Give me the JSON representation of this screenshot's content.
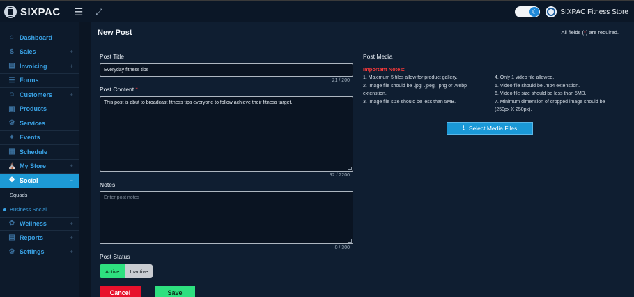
{
  "header": {
    "logo_text": "SIXPAC",
    "store_name": "SIXPAC Fitness Store",
    "menu_icon": "hamburger-icon",
    "expand_icon": "expand-icon",
    "theme_icon": "moon-icon"
  },
  "sidebar": {
    "items": [
      {
        "label": "Dashboard",
        "icon": "home-icon",
        "has_plus": false
      },
      {
        "label": "Sales",
        "icon": "dollar-icon",
        "has_plus": true
      },
      {
        "label": "Invoicing",
        "icon": "invoice-icon",
        "has_plus": true
      },
      {
        "label": "Forms",
        "icon": "form-icon",
        "has_plus": false
      },
      {
        "label": "Customers",
        "icon": "users-icon",
        "has_plus": true
      },
      {
        "label": "Products",
        "icon": "box-icon",
        "has_plus": false
      },
      {
        "label": "Services",
        "icon": "services-icon",
        "has_plus": false
      },
      {
        "label": "Events",
        "icon": "events-icon",
        "has_plus": false
      },
      {
        "label": "Schedule",
        "icon": "calendar-icon",
        "has_plus": false
      },
      {
        "label": "My Store",
        "icon": "store-icon",
        "has_plus": true
      },
      {
        "label": "Social",
        "icon": "social-icon",
        "has_plus": true,
        "active": true,
        "toggle": "−"
      }
    ],
    "sub_items": [
      {
        "label": "Squads"
      },
      {
        "label": "Business Social",
        "current": true
      }
    ],
    "items_after": [
      {
        "label": "Wellness",
        "icon": "wellness-icon",
        "has_plus": true
      },
      {
        "label": "Reports",
        "icon": "reports-icon",
        "has_plus": true
      },
      {
        "label": "Settings",
        "icon": "gear-icon",
        "has_plus": true
      }
    ],
    "plus_symbol": "+"
  },
  "form": {
    "page_title": "New Post",
    "required_prefix": "All fields (",
    "required_star": "*",
    "required_suffix": ") are required.",
    "post_title_label": "Post Title",
    "post_title_value": "Everyday fitness tips",
    "post_title_counter": "21 / 200",
    "post_content_label": "Post Content",
    "post_content_value": "This post is abut to broadcast fitness tips everyone to follow achieve their fitness target.",
    "post_content_counter": "92 / 2200",
    "notes_label": "Notes",
    "notes_placeholder": "Enter post notes",
    "notes_counter": "0 / 300",
    "status_label": "Post Status",
    "status_active": "Active",
    "status_inactive": "Inactive",
    "status_selected": "Active",
    "cancel_label": "Cancel",
    "save_label": "Save"
  },
  "media": {
    "title": "Post Media",
    "notes_title": "Important Notes:",
    "notes_left": [
      "1. Maximum 5 files allow for product gallery.",
      "2. Image file should be .jpg, .jpeg, .png or .webp extenstion.",
      "3. Image file size should be less than 5MB."
    ],
    "notes_right": [
      "4. Only 1 video file allowed.",
      "5. Video file should be .mp4 extenstion.",
      "6. Video file size should be less than 5MB.",
      "7. Minimum dimension of cropped image should be (250px X 250px)."
    ],
    "button_label": "Select Media Files",
    "button_icon": "upload-icon"
  }
}
